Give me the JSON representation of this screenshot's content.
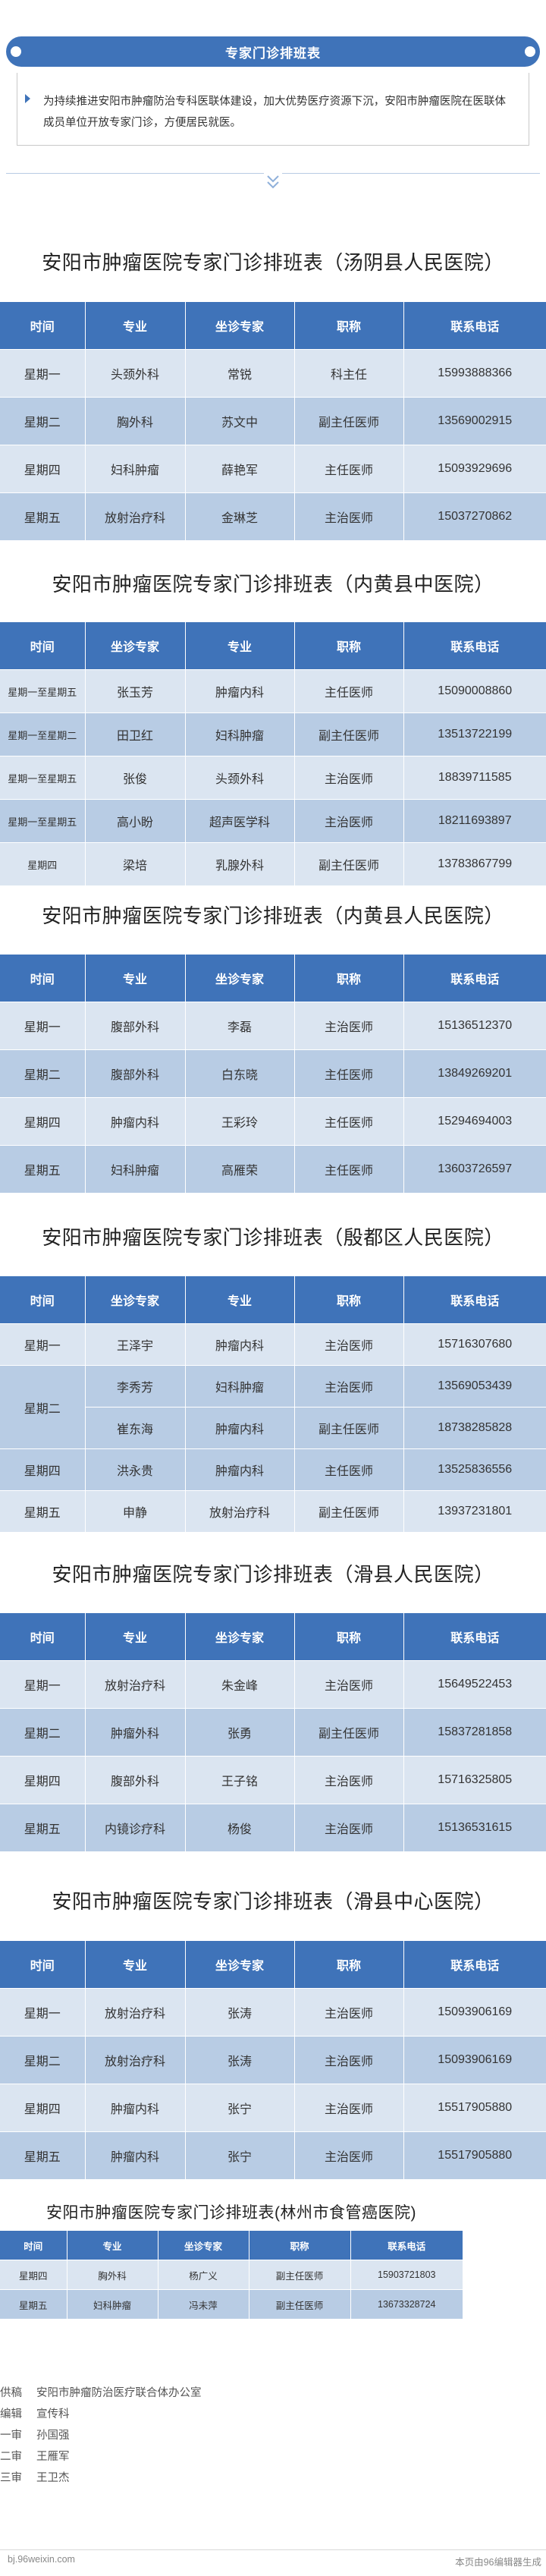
{
  "header": {
    "title": "专家门诊排班表",
    "intro": "为持续推进安阳市肿瘤防治专科医联体建设，加大优势医疗资源下沉，安阳市肿瘤医院在医联体成员单位开放专家门诊，方便居民就医。"
  },
  "colors": {
    "accent": "#3f73b9",
    "row_light": "#dbe5f1",
    "row_dark": "#b8cce4"
  },
  "sections": [
    {
      "title": "安阳市肿瘤医院专家门诊排班表（汤阴县人民医院）",
      "headers": [
        "时间",
        "专业",
        "坐诊专家",
        "职称",
        "联系电话"
      ],
      "rows": [
        [
          "星期一",
          "头颈外科",
          "常锐",
          "科主任",
          "15993888366"
        ],
        [
          "星期二",
          "胸外科",
          "苏文中",
          "副主任医师",
          "13569002915"
        ],
        [
          "星期四",
          "妇科肿瘤",
          "薛艳军",
          "主任医师",
          "15093929696"
        ],
        [
          "星期五",
          "放射治疗科",
          "金琳芝",
          "主治医师",
          "15037270862"
        ]
      ]
    },
    {
      "title": "安阳市肿瘤医院专家门诊排班表（内黄县中医院）",
      "headers": [
        "时间",
        "坐诊专家",
        "专业",
        "职称",
        "联系电话"
      ],
      "rows": [
        [
          "星期一至星期五",
          "张玉芳",
          "肿瘤内科",
          "主任医师",
          "15090008860"
        ],
        [
          "星期一至星期二",
          "田卫红",
          "妇科肿瘤",
          "副主任医师",
          "13513722199"
        ],
        [
          "星期一至星期五",
          "张俊",
          "头颈外科",
          "主治医师",
          "18839711585"
        ],
        [
          "星期一至星期五",
          "高小盼",
          "超声医学科",
          "主治医师",
          "18211693897"
        ],
        [
          "星期四",
          "梁培",
          "乳腺外科",
          "副主任医师",
          "13783867799"
        ]
      ]
    },
    {
      "title": "安阳市肿瘤医院专家门诊排班表（内黄县人民医院）",
      "headers": [
        "时间",
        "专业",
        "坐诊专家",
        "职称",
        "联系电话"
      ],
      "rows": [
        [
          "星期一",
          "腹部外科",
          "李磊",
          "主治医师",
          "15136512370"
        ],
        [
          "星期二",
          "腹部外科",
          "白东晓",
          "主任医师",
          "13849269201"
        ],
        [
          "星期四",
          "肿瘤内科",
          "王彩玲",
          "主任医师",
          "15294694003"
        ],
        [
          "星期五",
          "妇科肿瘤",
          "高雁荣",
          "主任医师",
          "13603726597"
        ]
      ]
    },
    {
      "title": "安阳市肿瘤医院专家门诊排班表（殷都区人民医院）",
      "headers": [
        "时间",
        "坐诊专家",
        "专业",
        "职称",
        "联系电话"
      ],
      "rows": [
        [
          "星期一",
          "王泽宇",
          "肿瘤内科",
          "主治医师",
          "15716307680"
        ],
        [
          "星期二",
          "李秀芳",
          "妇科肿瘤",
          "主治医师",
          "13569053439"
        ],
        [
          "",
          "崔东海",
          "肿瘤内科",
          "副主任医师",
          "18738285828"
        ],
        [
          "星期四",
          "洪永贵",
          "肿瘤内科",
          "主任医师",
          "13525836556"
        ],
        [
          "星期五",
          "申静",
          "放射治疗科",
          "副主任医师",
          "13937231801"
        ]
      ]
    },
    {
      "title": "安阳市肿瘤医院专家门诊排班表（滑县人民医院）",
      "headers": [
        "时间",
        "专业",
        "坐诊专家",
        "职称",
        "联系电话"
      ],
      "rows": [
        [
          "星期一",
          "放射治疗科",
          "朱金峰",
          "主治医师",
          "15649522453"
        ],
        [
          "星期二",
          "肿瘤外科",
          "张勇",
          "副主任医师",
          "15837281858"
        ],
        [
          "星期四",
          "腹部外科",
          "王子铭",
          "主治医师",
          "15716325805"
        ],
        [
          "星期五",
          "内镜诊疗科",
          "杨俊",
          "主治医师",
          "15136531615"
        ]
      ]
    },
    {
      "title": "安阳市肿瘤医院专家门诊排班表（滑县中心医院）",
      "headers": [
        "时间",
        "专业",
        "坐诊专家",
        "职称",
        "联系电话"
      ],
      "rows": [
        [
          "星期一",
          "放射治疗科",
          "张涛",
          "主治医师",
          "15093906169"
        ],
        [
          "星期二",
          "放射治疗科",
          "张涛",
          "主治医师",
          "15093906169"
        ],
        [
          "星期四",
          "肿瘤内科",
          "张宁",
          "主治医师",
          "15517905880"
        ],
        [
          "星期五",
          "肿瘤内科",
          "张宁",
          "主治医师",
          "15517905880"
        ]
      ]
    },
    {
      "title": "安阳市肿瘤医院专家门诊排班表(林州市食管癌医院)",
      "headers": [
        "时间",
        "专业",
        "坐诊专家",
        "职称",
        "联系电话"
      ],
      "rows": [
        [
          "星期四",
          "胸外科",
          "杨广义",
          "副主任医师",
          "15903721803"
        ],
        [
          "星期五",
          "妇科肿瘤",
          "冯未萍",
          "副主任医师",
          "13673328724"
        ]
      ]
    }
  ],
  "credits": [
    {
      "label": "供稿",
      "value": "安阳市肿瘤防治医疗联合体办公室"
    },
    {
      "label": "编辑",
      "value": "宣传科"
    },
    {
      "label": "一审",
      "value": "孙国强"
    },
    {
      "label": "二审",
      "value": "王雁军"
    },
    {
      "label": "三审",
      "value": "王卫杰"
    }
  ],
  "footer": {
    "left": "bj.96weixin.com",
    "right": "本页由96编辑器生成"
  }
}
